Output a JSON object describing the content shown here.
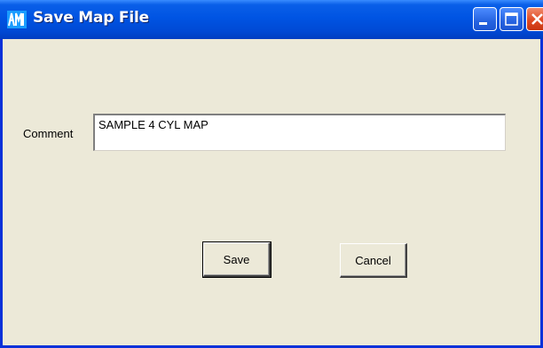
{
  "window": {
    "title": "Save Map File",
    "app_icon": "app-logo-icon",
    "controls": {
      "minimize_icon": "minimize-icon",
      "maximize_icon": "maximize-icon",
      "close_icon": "close-icon"
    }
  },
  "form": {
    "comment_label": "Comment",
    "comment_value": "SAMPLE 4 CYL MAP"
  },
  "buttons": {
    "save_label": "Save",
    "cancel_label": "Cancel"
  },
  "colors": {
    "titlebar": "#0054e3",
    "window_bg": "#ece9d8",
    "close_button": "#df4a23"
  }
}
